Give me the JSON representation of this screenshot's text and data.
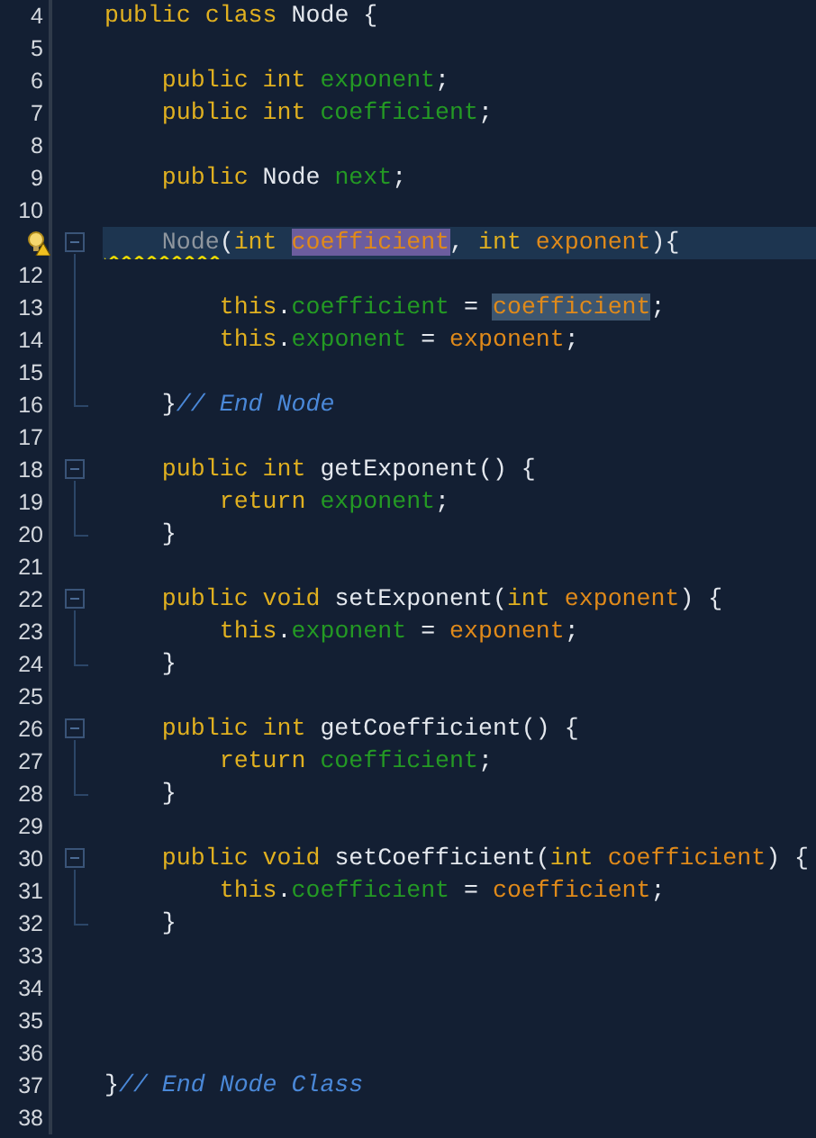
{
  "editor": {
    "lines": [
      {
        "number": "4",
        "tokens": [
          {
            "text": "public ",
            "kind": "keyword"
          },
          {
            "text": "class ",
            "kind": "keyword"
          },
          {
            "text": "Node {",
            "kind": "plain"
          }
        ]
      },
      {
        "number": "5"
      },
      {
        "number": "6",
        "tokens": [
          {
            "text": "    public ",
            "kind": "keyword"
          },
          {
            "text": "int ",
            "kind": "keyword"
          },
          {
            "text": "exponent",
            "kind": "field"
          },
          {
            "text": ";",
            "kind": "plain"
          }
        ]
      },
      {
        "number": "7",
        "tokens": [
          {
            "text": "    public ",
            "kind": "keyword"
          },
          {
            "text": "int ",
            "kind": "keyword"
          },
          {
            "text": "coefficient",
            "kind": "field"
          },
          {
            "text": ";",
            "kind": "plain"
          }
        ]
      },
      {
        "number": "8"
      },
      {
        "number": "9",
        "tokens": [
          {
            "text": "    public ",
            "kind": "keyword"
          },
          {
            "text": "Node ",
            "kind": "plain"
          },
          {
            "text": "next",
            "kind": "field"
          },
          {
            "text": ";",
            "kind": "plain"
          }
        ]
      },
      {
        "number": "10"
      },
      {
        "current": true,
        "hint": true,
        "fold_start": true,
        "tokens": [
          {
            "text": "    Node",
            "kind": "constructor",
            "warning": true
          },
          {
            "text": "(",
            "kind": "plain"
          },
          {
            "text": "int ",
            "kind": "keyword"
          },
          {
            "text": "coefficient",
            "kind": "param",
            "selected": true
          },
          {
            "text": ", ",
            "kind": "plain"
          },
          {
            "text": "int ",
            "kind": "keyword"
          },
          {
            "text": "exponent",
            "kind": "param"
          },
          {
            "text": "){",
            "kind": "plain"
          }
        ]
      },
      {
        "number": "12",
        "fold_body": true
      },
      {
        "number": "13",
        "fold_body": true,
        "tokens": [
          {
            "text": "        this",
            "kind": "keyword"
          },
          {
            "text": ".",
            "kind": "plain"
          },
          {
            "text": "coefficient",
            "kind": "field"
          },
          {
            "text": " = ",
            "kind": "plain"
          },
          {
            "text": "coefficient",
            "kind": "param",
            "highlighted": true
          },
          {
            "text": ";",
            "kind": "plain"
          }
        ]
      },
      {
        "number": "14",
        "fold_body": true,
        "tokens": [
          {
            "text": "        this",
            "kind": "keyword"
          },
          {
            "text": ".",
            "kind": "plain"
          },
          {
            "text": "exponent",
            "kind": "field"
          },
          {
            "text": " = ",
            "kind": "plain"
          },
          {
            "text": "exponent",
            "kind": "param"
          },
          {
            "text": ";",
            "kind": "plain"
          }
        ]
      },
      {
        "number": "15",
        "fold_body": true
      },
      {
        "number": "16",
        "fold_end": true,
        "tokens": [
          {
            "text": "    }",
            "kind": "plain"
          },
          {
            "text": "// End Node",
            "kind": "comment"
          }
        ]
      },
      {
        "number": "17"
      },
      {
        "number": "18",
        "fold_start": true,
        "tokens": [
          {
            "text": "    public ",
            "kind": "keyword"
          },
          {
            "text": "int ",
            "kind": "keyword"
          },
          {
            "text": "getExponent() {",
            "kind": "plain"
          }
        ]
      },
      {
        "number": "19",
        "fold_body": true,
        "tokens": [
          {
            "text": "        return ",
            "kind": "keyword"
          },
          {
            "text": "exponent",
            "kind": "field"
          },
          {
            "text": ";",
            "kind": "plain"
          }
        ]
      },
      {
        "number": "20",
        "fold_end": true,
        "tokens": [
          {
            "text": "    }",
            "kind": "plain"
          }
        ]
      },
      {
        "number": "21"
      },
      {
        "number": "22",
        "fold_start": true,
        "tokens": [
          {
            "text": "    public ",
            "kind": "keyword"
          },
          {
            "text": "void ",
            "kind": "keyword"
          },
          {
            "text": "setExponent(",
            "kind": "plain"
          },
          {
            "text": "int ",
            "kind": "keyword"
          },
          {
            "text": "exponent",
            "kind": "param"
          },
          {
            "text": ") {",
            "kind": "plain"
          }
        ]
      },
      {
        "number": "23",
        "fold_body": true,
        "tokens": [
          {
            "text": "        this",
            "kind": "keyword"
          },
          {
            "text": ".",
            "kind": "plain"
          },
          {
            "text": "exponent",
            "kind": "field"
          },
          {
            "text": " = ",
            "kind": "plain"
          },
          {
            "text": "exponent",
            "kind": "param"
          },
          {
            "text": ";",
            "kind": "plain"
          }
        ]
      },
      {
        "number": "24",
        "fold_end": true,
        "tokens": [
          {
            "text": "    }",
            "kind": "plain"
          }
        ]
      },
      {
        "number": "25"
      },
      {
        "number": "26",
        "fold_start": true,
        "tokens": [
          {
            "text": "    public ",
            "kind": "keyword"
          },
          {
            "text": "int ",
            "kind": "keyword"
          },
          {
            "text": "getCoefficient() {",
            "kind": "plain"
          }
        ]
      },
      {
        "number": "27",
        "fold_body": true,
        "tokens": [
          {
            "text": "        return ",
            "kind": "keyword"
          },
          {
            "text": "coefficient",
            "kind": "field"
          },
          {
            "text": ";",
            "kind": "plain"
          }
        ]
      },
      {
        "number": "28",
        "fold_end": true,
        "tokens": [
          {
            "text": "    }",
            "kind": "plain"
          }
        ]
      },
      {
        "number": "29"
      },
      {
        "number": "30",
        "fold_start": true,
        "tokens": [
          {
            "text": "    public ",
            "kind": "keyword"
          },
          {
            "text": "void ",
            "kind": "keyword"
          },
          {
            "text": "setCoefficient(",
            "kind": "plain"
          },
          {
            "text": "int ",
            "kind": "keyword"
          },
          {
            "text": "coefficient",
            "kind": "param"
          },
          {
            "text": ") {",
            "kind": "plain"
          }
        ]
      },
      {
        "number": "31",
        "fold_body": true,
        "tokens": [
          {
            "text": "        this",
            "kind": "keyword"
          },
          {
            "text": ".",
            "kind": "plain"
          },
          {
            "text": "coefficient",
            "kind": "field"
          },
          {
            "text": " = ",
            "kind": "plain"
          },
          {
            "text": "coefficient",
            "kind": "param"
          },
          {
            "text": ";",
            "kind": "plain"
          }
        ]
      },
      {
        "number": "32",
        "fold_end": true,
        "tokens": [
          {
            "text": "    }",
            "kind": "plain"
          }
        ]
      },
      {
        "number": "33"
      },
      {
        "number": "34"
      },
      {
        "number": "35"
      },
      {
        "number": "36"
      },
      {
        "number": "37",
        "tokens": [
          {
            "text": "}",
            "kind": "plain"
          },
          {
            "text": "// End Node Class",
            "kind": "comment"
          }
        ]
      },
      {
        "number": "38"
      }
    ]
  }
}
